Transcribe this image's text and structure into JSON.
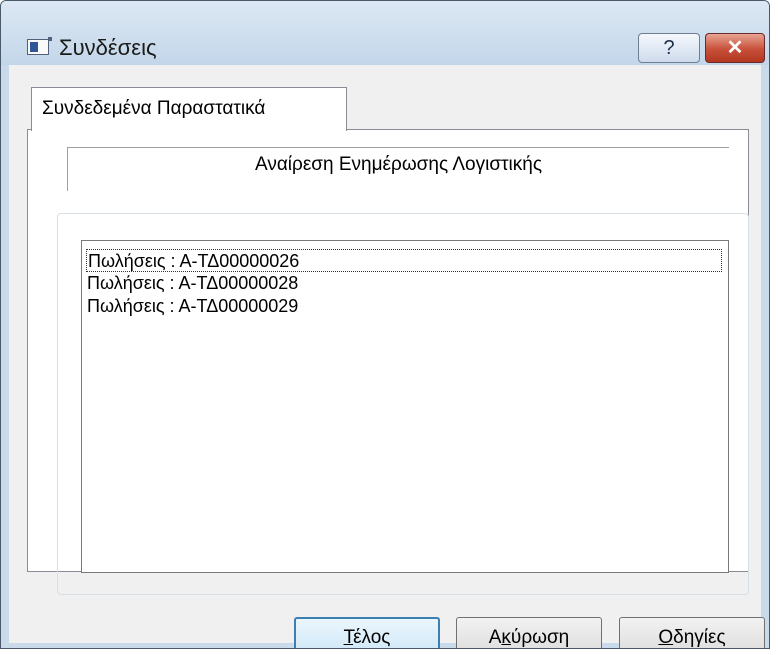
{
  "window": {
    "title": "Συνδέσεις",
    "help_glyph": "?",
    "close_glyph": "✕",
    "icon": "application-window-icon"
  },
  "tab": {
    "label": "Συνδεδεμένα Παραστατικά"
  },
  "header": {
    "text": "Αναίρεση Ενημέρωσης Λογιστικής"
  },
  "list": {
    "items": [
      "Πωλήσεις : Α-ΤΔ00000026",
      "Πωλήσεις : Α-ΤΔ00000028",
      "Πωλήσεις : Α-ΤΔ00000029"
    ],
    "focused_index": 0
  },
  "buttons": {
    "ok": {
      "mnemonic": "Τ",
      "rest": "έλος"
    },
    "cancel": {
      "pre": "Α",
      "mnemonic": "κ",
      "rest": "ύρωση"
    },
    "help": {
      "mnemonic": "Ο",
      "rest": "δηγίες"
    }
  },
  "colors": {
    "titlebar": "#c9daea",
    "close_button": "#c7503a",
    "default_button_border": "#3c7fb1"
  }
}
